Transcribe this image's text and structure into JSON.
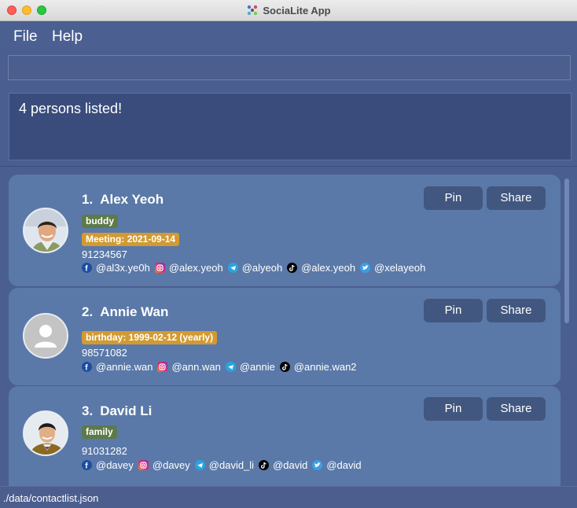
{
  "window": {
    "title": "SociaLite App"
  },
  "menu": {
    "file": "File",
    "help": "Help"
  },
  "command": {
    "value": ""
  },
  "result": {
    "text": "4 persons listed!"
  },
  "persons": [
    {
      "index": "1.",
      "name": "Alex Yeoh",
      "tags": [
        {
          "label": "buddy",
          "color": "#5d7a49"
        },
        {
          "label": "Meeting: 2021-09-14",
          "color": "#d29a31"
        }
      ],
      "phone": "91234567",
      "socials": {
        "facebook": "@al3x.ye0h",
        "instagram": "@alex.yeoh",
        "telegram": "@alyeoh",
        "tiktok": "@alex.yeoh",
        "twitter": "@xelayeoh"
      },
      "pin_label": "Pin",
      "share_label": "Share"
    },
    {
      "index": "2.",
      "name": "Annie Wan",
      "tags": [
        {
          "label": "birthday: 1999-02-12 (yearly)",
          "color": "#d29a31"
        }
      ],
      "phone": "98571082",
      "socials": {
        "facebook": "@annie.wan",
        "instagram": "@ann.wan",
        "telegram": "@annie",
        "tiktok": "@annie.wan2"
      },
      "pin_label": "Pin",
      "share_label": "Share"
    },
    {
      "index": "3.",
      "name": "David Li",
      "tags": [
        {
          "label": "family",
          "color": "#5d7a49"
        }
      ],
      "phone": "91031282",
      "socials": {
        "facebook": "@davey",
        "instagram": "@davey",
        "telegram": "@david_li",
        "tiktok": "@david",
        "twitter": "@david"
      },
      "pin_label": "Pin",
      "share_label": "Share"
    }
  ],
  "status": {
    "path": "./data/contactlist.json"
  },
  "icons": {
    "facebook": "facebook-icon",
    "instagram": "instagram-icon",
    "telegram": "telegram-icon",
    "tiktok": "tiktok-icon",
    "twitter": "twitter-icon"
  },
  "colors": {
    "background": "#4a5f8f",
    "card": "#5a79a8",
    "button": "#41577f",
    "tag_green": "#5d7a49",
    "tag_gold": "#d29a31",
    "result_box": "#394c7b"
  }
}
